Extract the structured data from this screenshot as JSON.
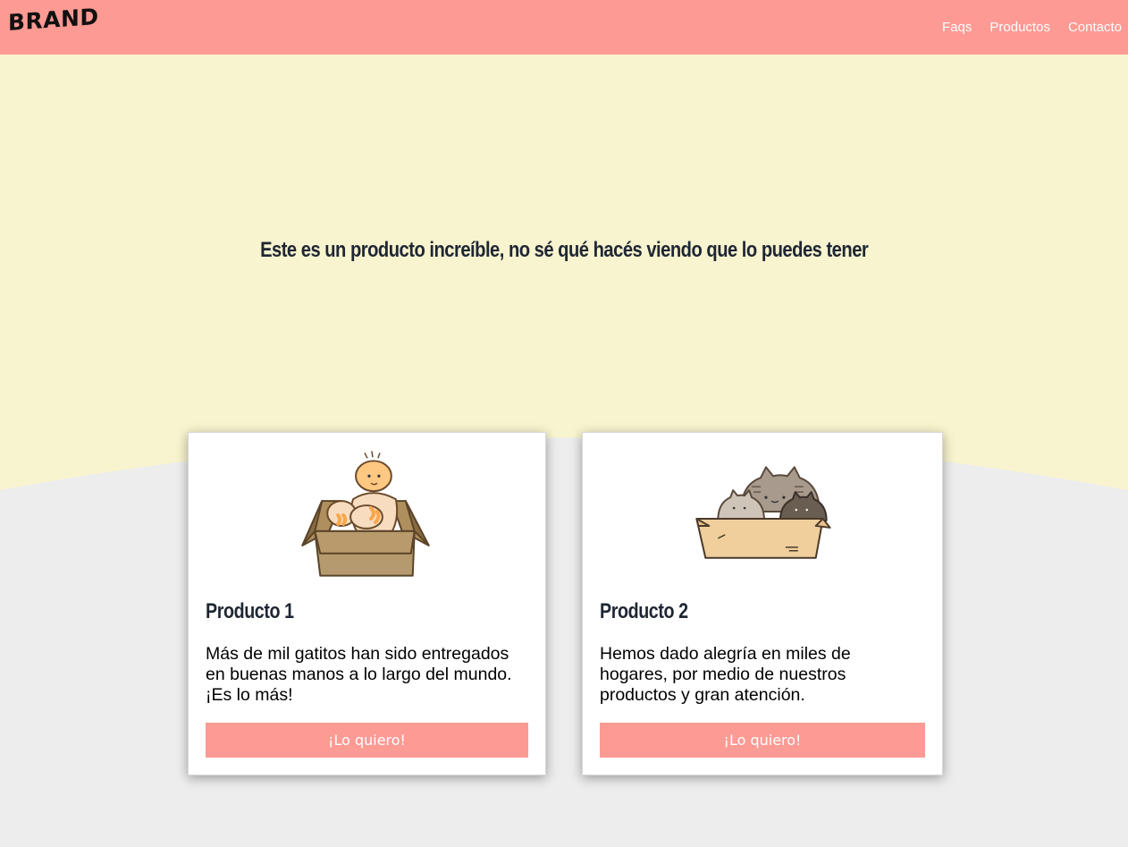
{
  "navbar": {
    "brand": "BRAND",
    "links": [
      "Faqs",
      "Productos",
      "Contacto"
    ],
    "background": "#fd9a93"
  },
  "hero": {
    "title": "Este es un producto increíble, no sé qué hacés viendo que lo puedes tener",
    "background": "#f8f4cf"
  },
  "products": [
    {
      "title": "Producto 1",
      "description": "Más de mil gatitos han sido entregados en buenas manos a lo largo del mundo. ¡Es lo más!",
      "button_label": "¡Lo quiero!",
      "image": "baby-in-box-illustration"
    },
    {
      "title": "Producto 2",
      "description": "Hemos dado alegría en miles de hogares, por medio de nuestros productos y gran atención.",
      "button_label": "¡Lo quiero!",
      "image": "cats-in-box-illustration"
    }
  ],
  "colors": {
    "accent": "#fc9a94",
    "page_background": "#ededed",
    "heading": "#1f2633"
  }
}
